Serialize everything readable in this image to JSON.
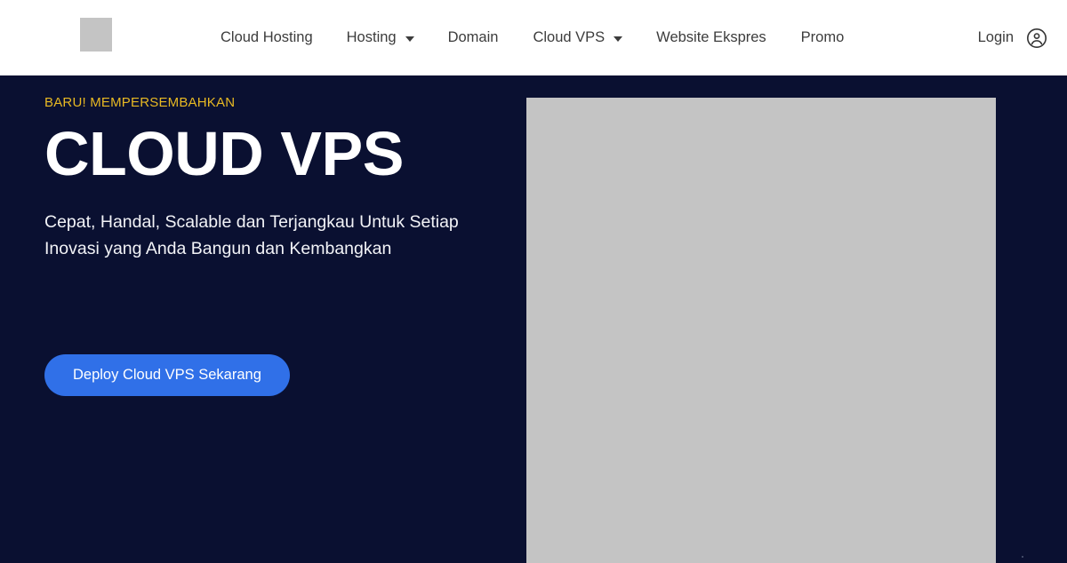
{
  "header": {
    "logo_alt": "site-logo",
    "nav_items": [
      {
        "label": "Cloud Hosting",
        "has_dropdown": false
      },
      {
        "label": "Hosting",
        "has_dropdown": true
      },
      {
        "label": "Domain",
        "has_dropdown": false
      },
      {
        "label": "Cloud VPS",
        "has_dropdown": true
      },
      {
        "label": "Website Ekspres",
        "has_dropdown": false
      },
      {
        "label": "Promo",
        "has_dropdown": false
      }
    ],
    "login_label": "Login",
    "account_icon": "account-circle-icon"
  },
  "hero": {
    "eyebrow": "BARU! MEMPERSEMBAHKAN",
    "title": "CLOUD VPS",
    "subtitle": "Cepat, Handal, Scalable dan Terjangkau Untuk Setiap Inovasi yang Anda Bangun dan Kembangkan",
    "cta_label": "Deploy Cloud VPS Sekarang",
    "media_alt": "hero-image-placeholder"
  },
  "colors": {
    "hero_background": "#0a1031",
    "header_background": "#ffffff",
    "eyebrow_text": "#e8b923",
    "cta_background": "#3070e8",
    "cta_text": "#ffffff",
    "nav_text": "#3c3c3c",
    "placeholder_gray": "#c4c4c4"
  }
}
